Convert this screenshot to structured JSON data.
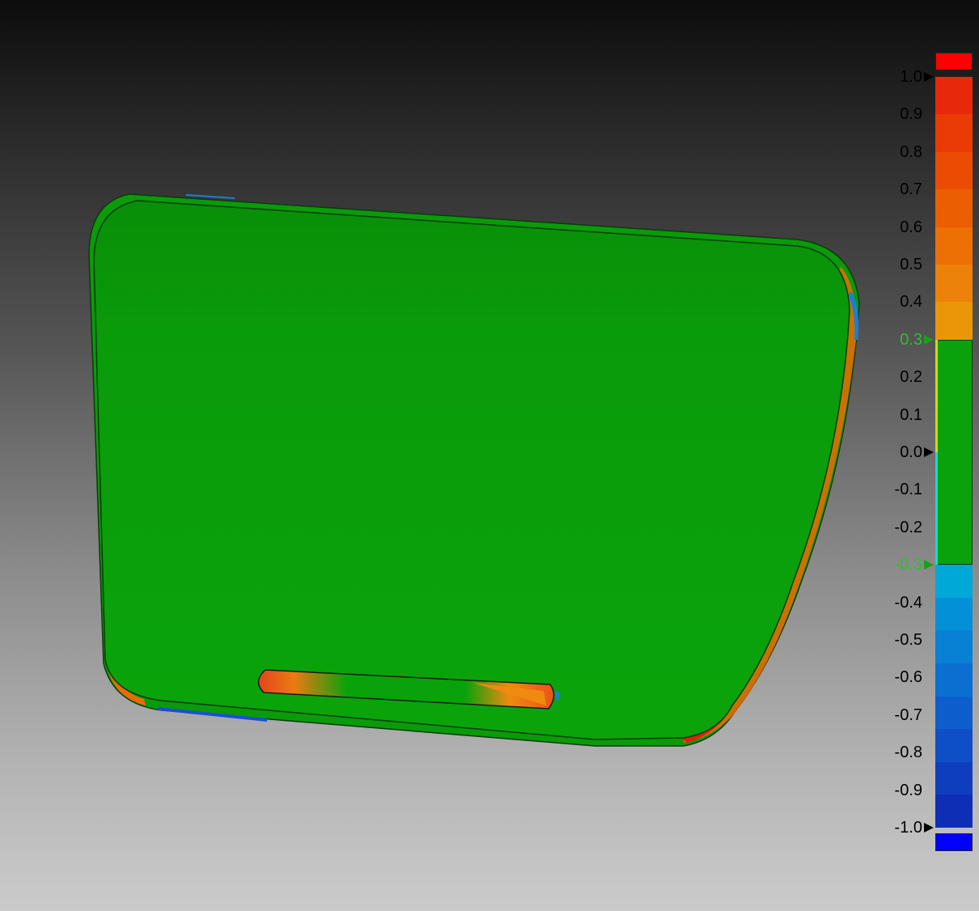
{
  "legend": {
    "labels": [
      "1.0",
      "0.9",
      "0.8",
      "0.7",
      "0.6",
      "0.5",
      "0.4",
      "0.3",
      "0.2",
      "0.1",
      "0.0",
      "-0.1",
      "-0.2",
      "-0.3",
      "-0.4",
      "-0.5",
      "-0.6",
      "-0.7",
      "-0.8",
      "-0.9",
      "-1.0"
    ],
    "tolerance_labels": [
      "0.3",
      "-0.3"
    ],
    "colors": {
      "over_cap": "#ff0000",
      "under_cap": "#0000ff",
      "in_tolerance": "#0aa20a",
      "upper_bands": [
        "#e8280a",
        "#ea3a06",
        "#eb4c04",
        "#ec5e02",
        "#ed7004",
        "#ec820a",
        "#eb9606",
        "#eaae02"
      ],
      "lower_bands": [
        "#00a8d8",
        "#0490d6",
        "#0880d4",
        "#0a6fd0",
        "#0c5ecc",
        "#0e4ec6",
        "#0e3ebe",
        "#0e2eb6"
      ]
    },
    "marker_icon": "triangle-marker-icon"
  },
  "model": {
    "surface_color": "#0aa20a",
    "deviation_warm": "#ec6a06",
    "deviation_cool": "#1a7fd6"
  }
}
